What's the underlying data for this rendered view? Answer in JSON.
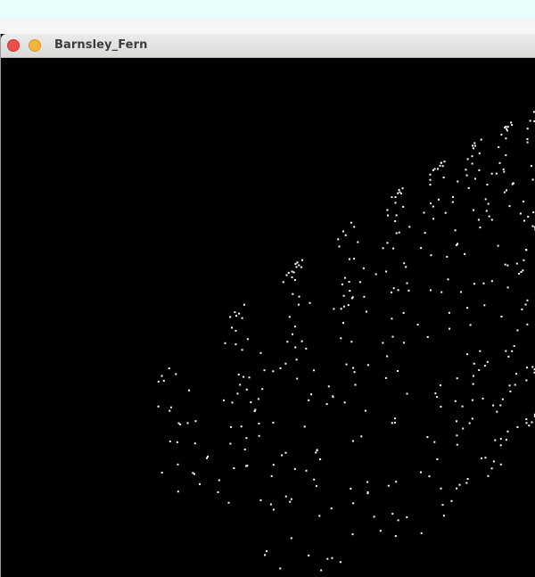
{
  "window": {
    "title": "Barnsley_Fern",
    "buttons": {
      "close": "close-icon",
      "minimize": "minimize-icon"
    }
  },
  "canvas": {
    "background_color": "#000000",
    "point_color": "#ffffff",
    "content": "fern-fractal-points"
  }
}
